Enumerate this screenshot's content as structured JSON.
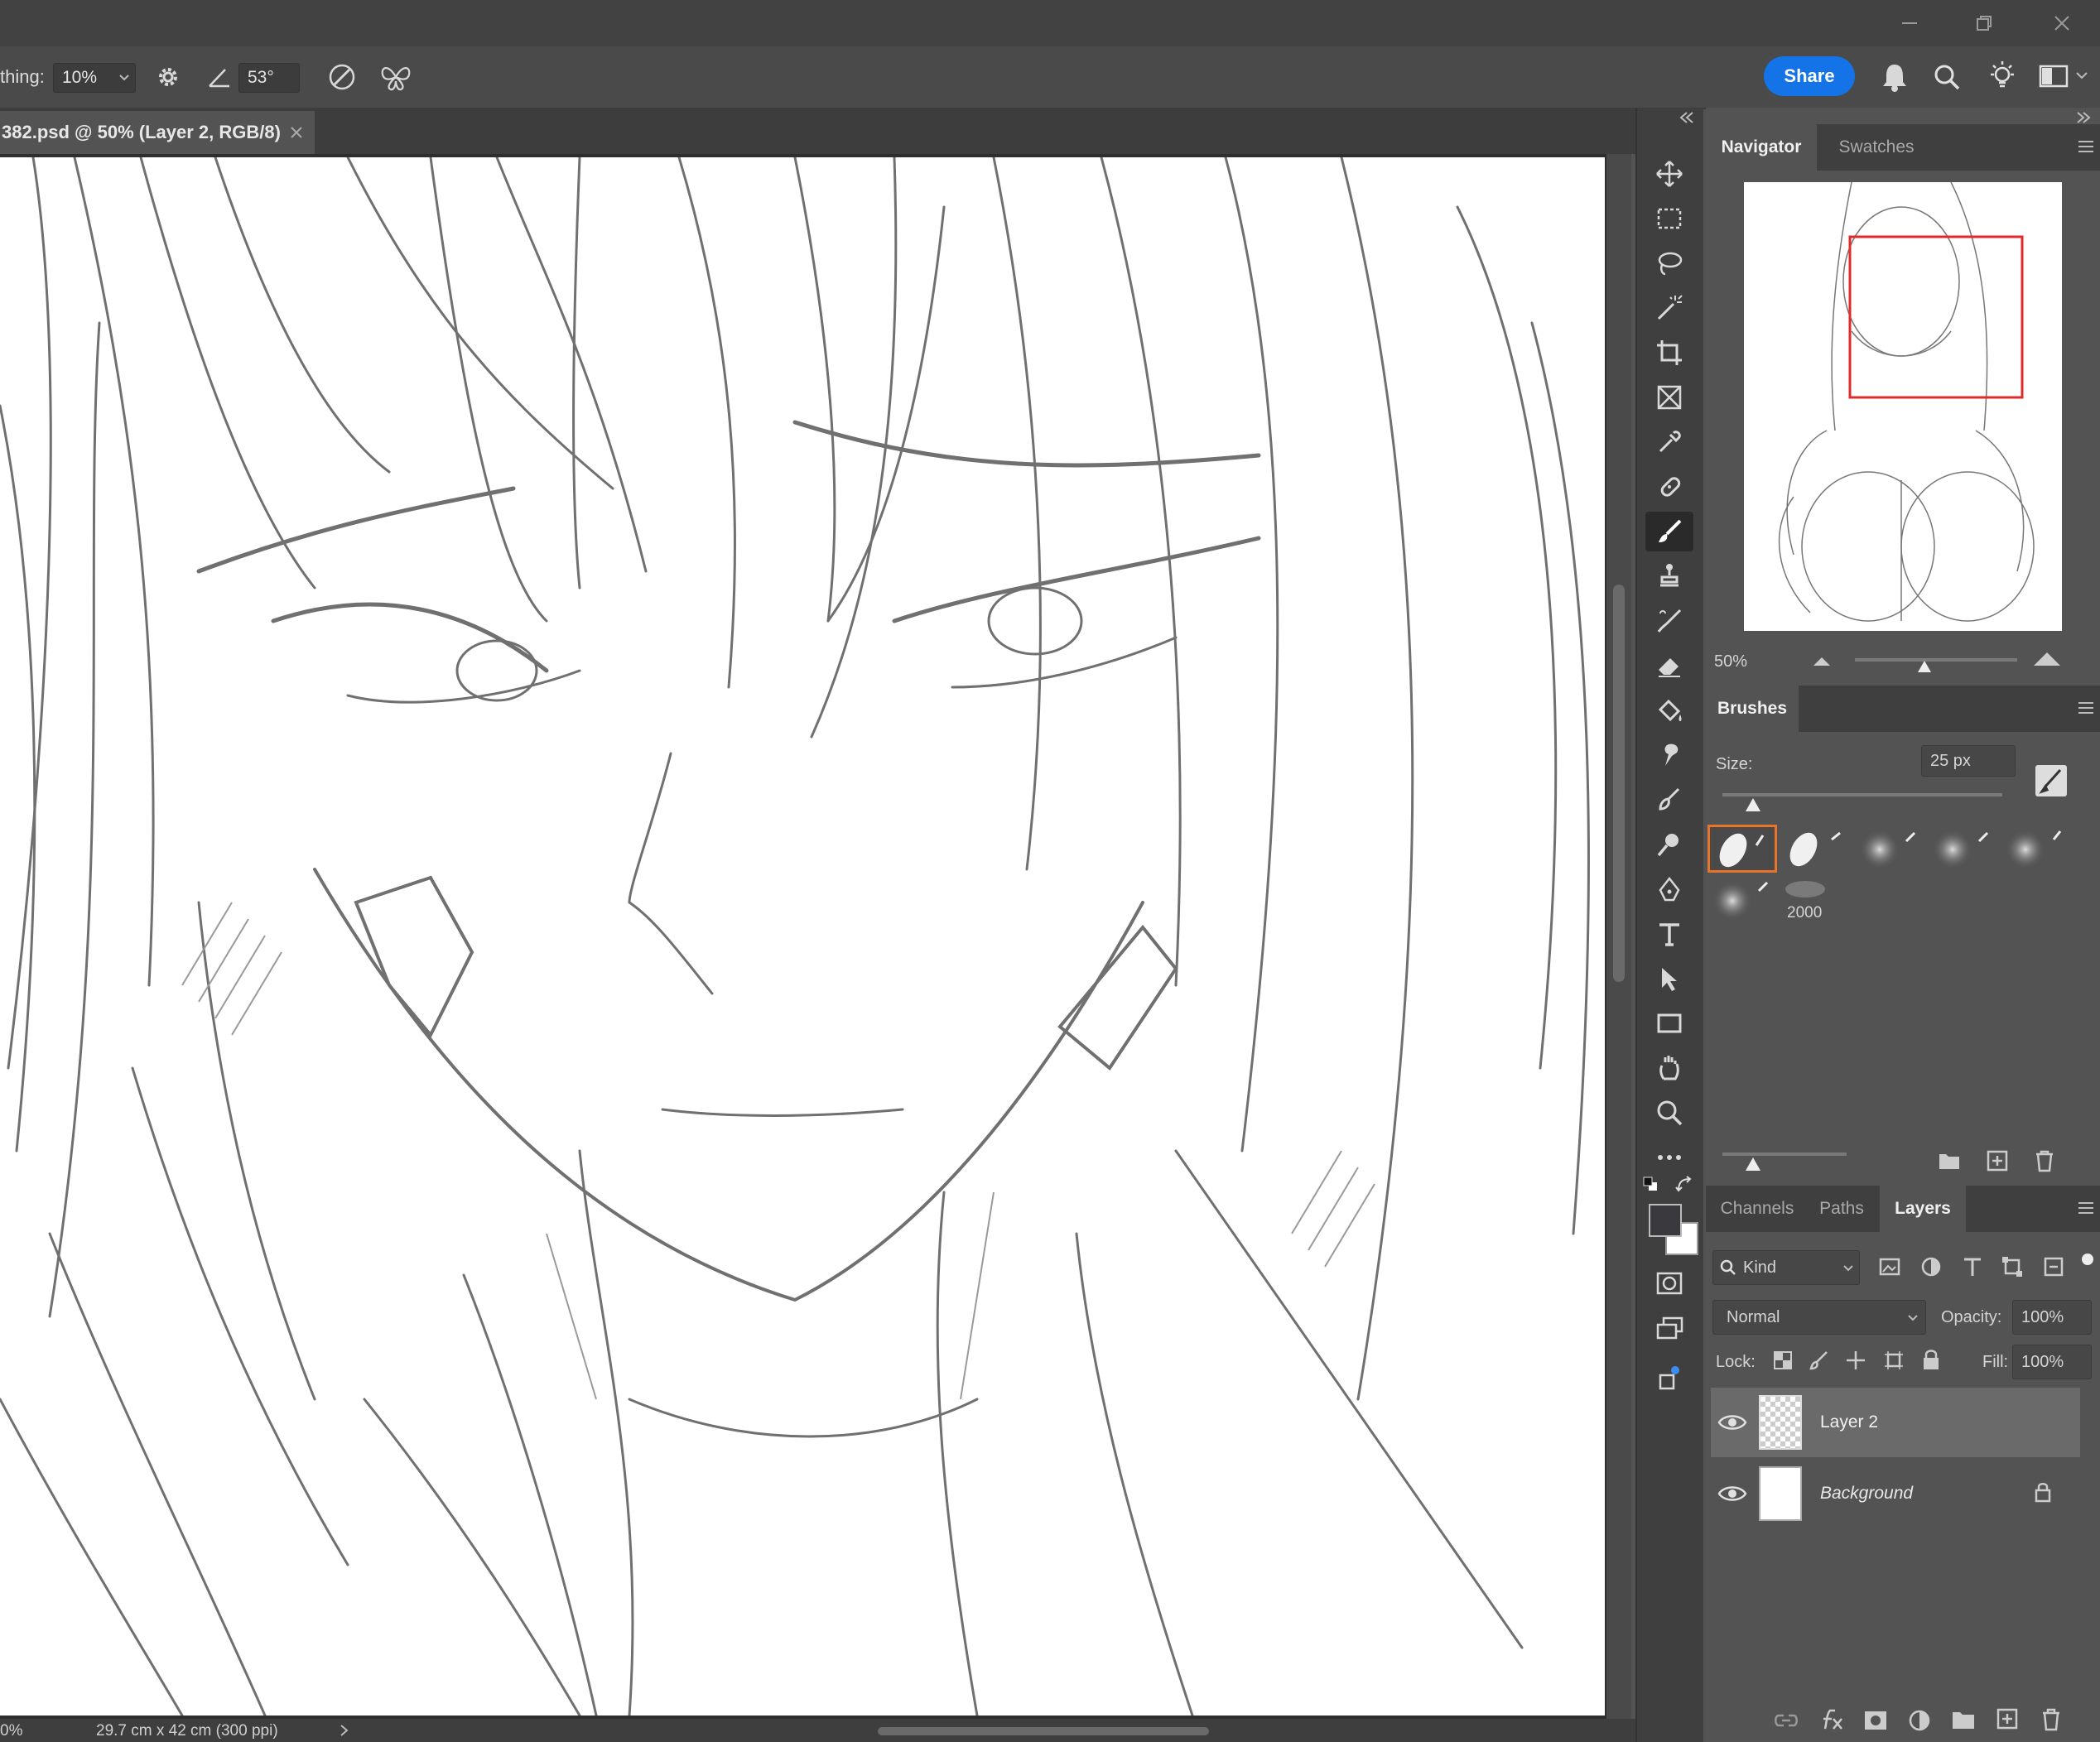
{
  "options_bar": {
    "smoothing_label": "thing:",
    "smoothing_value": "10%",
    "angle_value": "53°",
    "share_label": "Share"
  },
  "document": {
    "tab_title": "382.psd @ 50% (Layer 2, RGB/8)",
    "status_zoom": "0%",
    "status_info": "29.7 cm x 42 cm (300 ppi)"
  },
  "navigator": {
    "tabs": [
      "Navigator",
      "Swatches"
    ],
    "zoom": "50%"
  },
  "brushes": {
    "title": "Brushes",
    "size_label": "Size:",
    "size_value": "25 px",
    "preset_count_label": "2000"
  },
  "layers_panel": {
    "tabs": [
      "Channels",
      "Paths",
      "Layers"
    ],
    "filter_kind": "Kind",
    "blend_mode": "Normal",
    "opacity_label": "Opacity:",
    "opacity_value": "100%",
    "lock_label": "Lock:",
    "fill_label": "Fill:",
    "fill_value": "100%",
    "layers": [
      {
        "name": "Layer 2",
        "selected": true,
        "visible": true,
        "locked": false
      },
      {
        "name": "Background",
        "selected": false,
        "visible": true,
        "locked": true
      }
    ]
  },
  "colors": {
    "accent": "#1473e6",
    "panel_bg": "#535353",
    "active_brush_border": "#e8742a",
    "navigator_view_box": "#e02b2b"
  },
  "tools": [
    "move-icon",
    "marquee-icon",
    "lasso-icon",
    "magic-wand-icon",
    "crop-icon",
    "frame-icon",
    "eyedropper-icon",
    "healing-icon",
    "brush-icon",
    "stamp-icon",
    "history-brush-icon",
    "eraser-icon",
    "bucket-icon",
    "blur-icon",
    "dodge-icon",
    "pen-icon",
    "type-icon",
    "path-select-icon",
    "rectangle-icon",
    "hand-icon",
    "zoom-icon",
    "more-icon"
  ]
}
